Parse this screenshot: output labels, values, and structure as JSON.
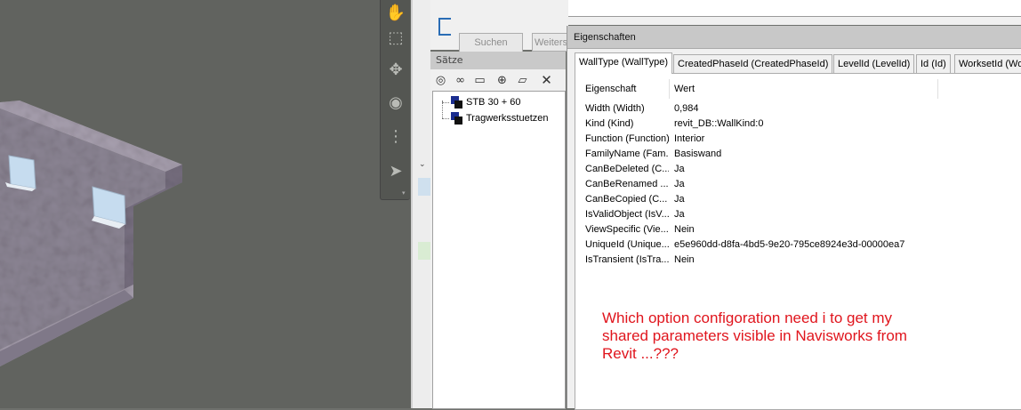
{
  "search_panel": {
    "search_button": "Suchen",
    "next_button": "Weiters"
  },
  "sets_panel": {
    "title": "Sätze",
    "toolbar_icons": [
      "save-search-icon",
      "binoculars-icon",
      "folder-icon",
      "add-set-icon",
      "comment-icon",
      "delete-icon"
    ],
    "items": [
      {
        "label": "STB 30 + 60"
      },
      {
        "label": "Tragwerksstuetzen"
      }
    ]
  },
  "properties": {
    "title": "Eigenschaften",
    "tabs": [
      {
        "label": "WallType (WallType)",
        "active": true
      },
      {
        "label": "CreatedPhaseId (CreatedPhaseId)"
      },
      {
        "label": "LevelId (LevelId)"
      },
      {
        "label": "Id (Id)"
      },
      {
        "label": "WorksetId (Wo"
      }
    ],
    "columns": {
      "property": "Eigenschaft",
      "value": "Wert"
    },
    "rows": [
      {
        "k": "Width (Width)",
        "v": "0,984"
      },
      {
        "k": "Kind (Kind)",
        "v": "revit_DB::WallKind:0"
      },
      {
        "k": "Function (Function)",
        "v": "Interior"
      },
      {
        "k": "FamilyName (Fam...",
        "v": "Basiswand"
      },
      {
        "k": "CanBeDeleted (C...",
        "v": "Ja"
      },
      {
        "k": "CanBeRenamed ...",
        "v": "Ja"
      },
      {
        "k": "CanBeCopied (C...",
        "v": "Ja"
      },
      {
        "k": "IsValidObject (IsV...",
        "v": "Ja"
      },
      {
        "k": "ViewSpecific (Vie...",
        "v": "Nein"
      },
      {
        "k": "UniqueId (Unique...",
        "v": "e5e960dd-d8fa-4bd5-9e20-795ce8924e3d-00000ea7"
      },
      {
        "k": "IsTransient (IsTra...",
        "v": "Nein"
      }
    ]
  },
  "annotation": {
    "line1": "Which option configoration need i to get my",
    "line2": "shared parameters visible in Navisworks from",
    "line3": "Revit ...???"
  },
  "colors": {
    "annotation": "#e0151d",
    "viewport_bg": "#61635f",
    "wall": "#8e8796",
    "window_glass": "#c6dcef"
  },
  "nav_icons": [
    "pan-hand-icon",
    "zoom-window-icon",
    "orbit-icon",
    "look-around-icon",
    "walk-icon",
    "select-icon"
  ]
}
